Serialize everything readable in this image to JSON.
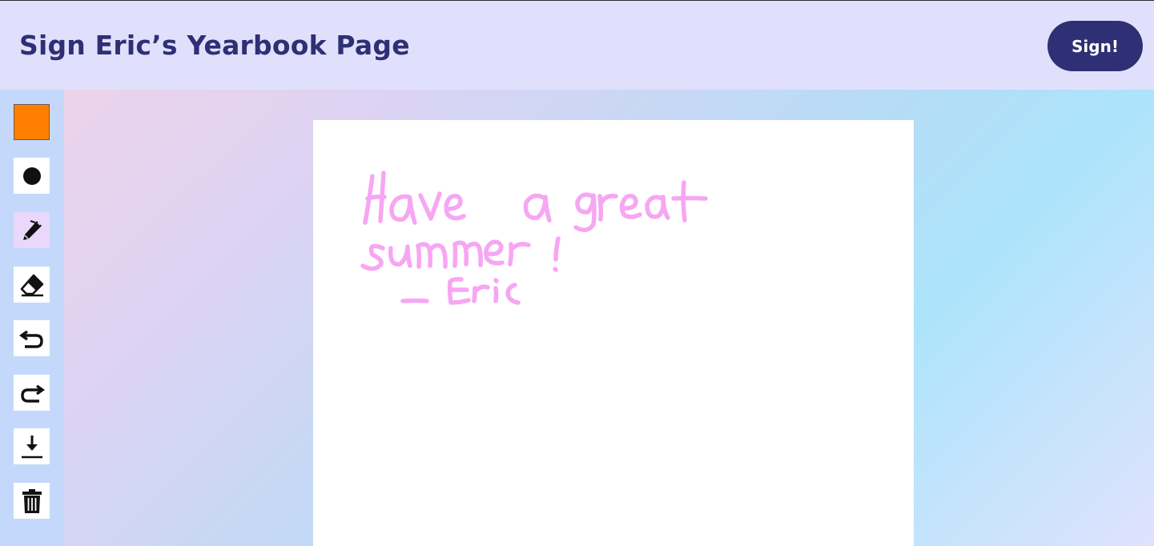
{
  "header": {
    "title": "Sign Eric’s Yearbook Page",
    "sign_button_label": "Sign!"
  },
  "toolbar": {
    "color_swatch": {
      "color": "#ff8000",
      "icon": "color-swatch"
    },
    "tools": [
      {
        "name": "brush-size",
        "icon": "filled-circle-icon",
        "active": false
      },
      {
        "name": "pen",
        "icon": "pen-icon",
        "active": true
      },
      {
        "name": "eraser",
        "icon": "eraser-icon",
        "active": false
      },
      {
        "name": "undo",
        "icon": "undo-icon",
        "active": false
      },
      {
        "name": "redo",
        "icon": "redo-icon",
        "active": false
      },
      {
        "name": "download",
        "icon": "download-icon",
        "active": false
      },
      {
        "name": "clear",
        "icon": "trash-icon",
        "active": false
      }
    ]
  },
  "canvas": {
    "handwriting": [
      "Have a great",
      "summer!",
      "- Eric"
    ],
    "ink_color": "#f7a6f3"
  },
  "colors": {
    "header_bg": "#e0e0fc",
    "accent": "#2e2f74",
    "sidebar_bg": "#c4d8fb"
  }
}
